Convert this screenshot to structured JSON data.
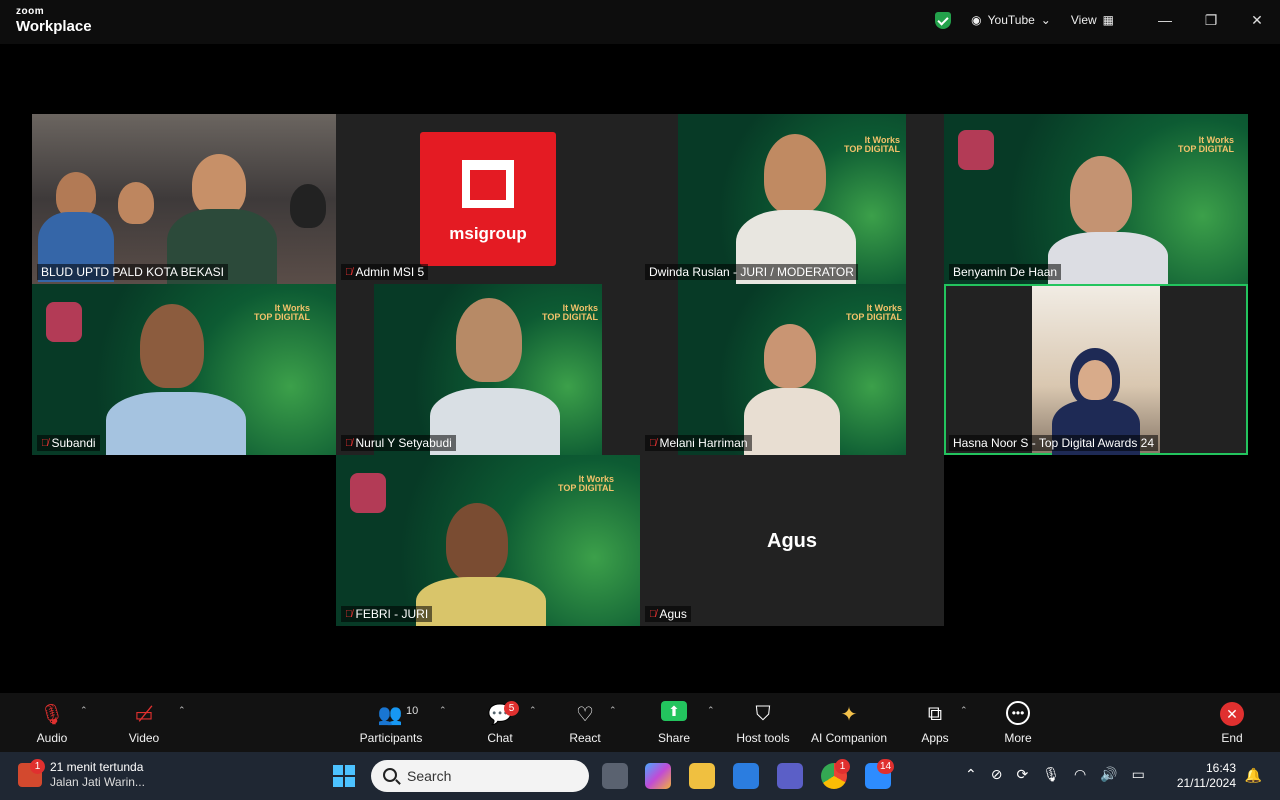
{
  "app": {
    "brand_top": "zoom",
    "brand_bottom": "Workplace",
    "share_source": "YouTube",
    "view_label": "View"
  },
  "tiles": [
    {
      "name": "BLUD UPTD PALD KOTA BEKASI",
      "muted": false
    },
    {
      "name": "Admin MSI 5",
      "muted": true,
      "logo_text": "msigroup"
    },
    {
      "name": "Dwinda Ruslan - JURI / MODERATOR",
      "muted": false
    },
    {
      "name": "Benyamin De Haan",
      "muted": false
    },
    {
      "name": "Subandi",
      "muted": true
    },
    {
      "name": "Nurul Y Setyabudi",
      "muted": true
    },
    {
      "name": "Melani Harriman",
      "muted": true
    },
    {
      "name": "Hasna Noor S - Top Digital Awards 24",
      "muted": false
    },
    {
      "name": "FEBRI - JURI",
      "muted": true
    },
    {
      "name": "Agus",
      "muted": true,
      "display_name": "Agus"
    }
  ],
  "toolbar": {
    "audio": "Audio",
    "video": "Video",
    "participants": "Participants",
    "participants_count": "10",
    "chat": "Chat",
    "chat_badge": "5",
    "react": "React",
    "share": "Share",
    "host_tools": "Host tools",
    "ai_companion": "AI Companion",
    "apps": "Apps",
    "more": "More",
    "end": "End"
  },
  "taskbar": {
    "weather_badge": "1",
    "weather_line1": "21 menit tertunda",
    "weather_line2": "Jalan Jati Warin...",
    "search_placeholder": "Search",
    "chrome_badge": "1",
    "zoom_badge": "14",
    "time": "16:43",
    "date": "21/11/2024"
  },
  "colors": {
    "accent_green": "#23c45e",
    "end_red": "#e0302f",
    "msi_red": "#e41b23"
  }
}
